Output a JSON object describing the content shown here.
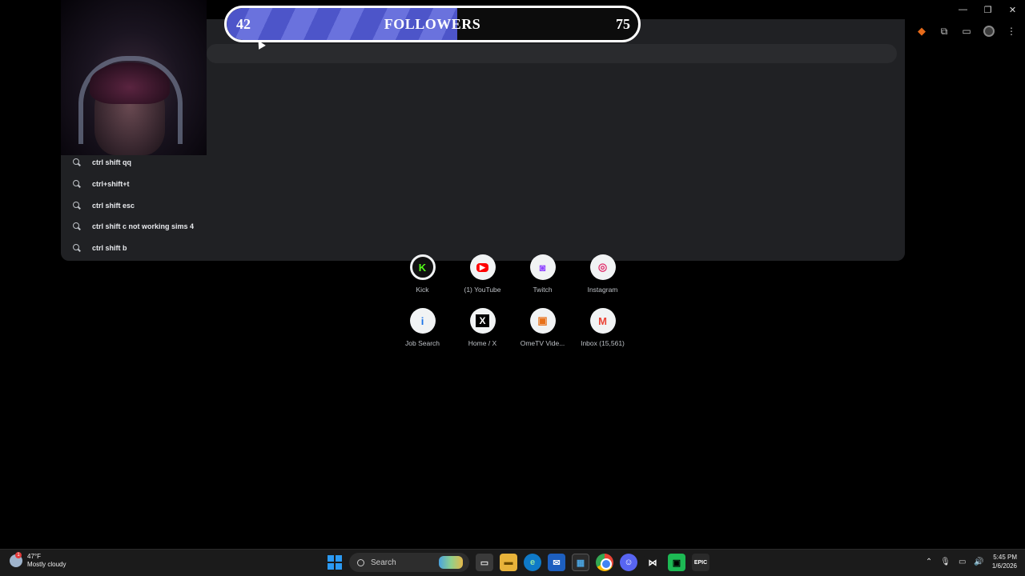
{
  "browser": {
    "suggestions": [
      {
        "label": "ctrl shift qq"
      },
      {
        "label": "ctrl+shift+t"
      },
      {
        "label": "ctrl shift esc"
      },
      {
        "label": "ctrl shift c not working sims 4"
      },
      {
        "label": "ctrl shift b"
      }
    ],
    "shortcuts": [
      {
        "label": "Kick",
        "icon": "kick-icon",
        "glyph": "K"
      },
      {
        "label": "(1) YouTube",
        "icon": "youtube-icon",
        "glyph": "▶"
      },
      {
        "label": "Twitch",
        "icon": "twitch-icon",
        "glyph": "◙"
      },
      {
        "label": "Instagram",
        "icon": "instagram-icon",
        "glyph": "◎"
      },
      {
        "label": "Job Search",
        "icon": "job-search-icon",
        "glyph": "i"
      },
      {
        "label": "Home / X",
        "icon": "x-icon",
        "glyph": "X"
      },
      {
        "label": "OmeTV Vide...",
        "icon": "ometv-icon",
        "glyph": "▣"
      },
      {
        "label": "Inbox (15,561)",
        "icon": "gmail-icon",
        "glyph": "M"
      }
    ]
  },
  "overlay": {
    "followers": {
      "current": "42",
      "label": "FOLLOWERS",
      "goal": "75",
      "progress_fraction": 0.56
    }
  },
  "taskbar": {
    "weather": {
      "temp": "47°F",
      "condition": "Mostly cloudy",
      "badge": "1"
    },
    "search_label": "Search",
    "clock": {
      "time": "5:45 PM",
      "date": "1/6/2026"
    }
  },
  "colors": {
    "accent": "#4d55c9",
    "panel": "#202124",
    "taskbar": "#1b1b1b"
  }
}
